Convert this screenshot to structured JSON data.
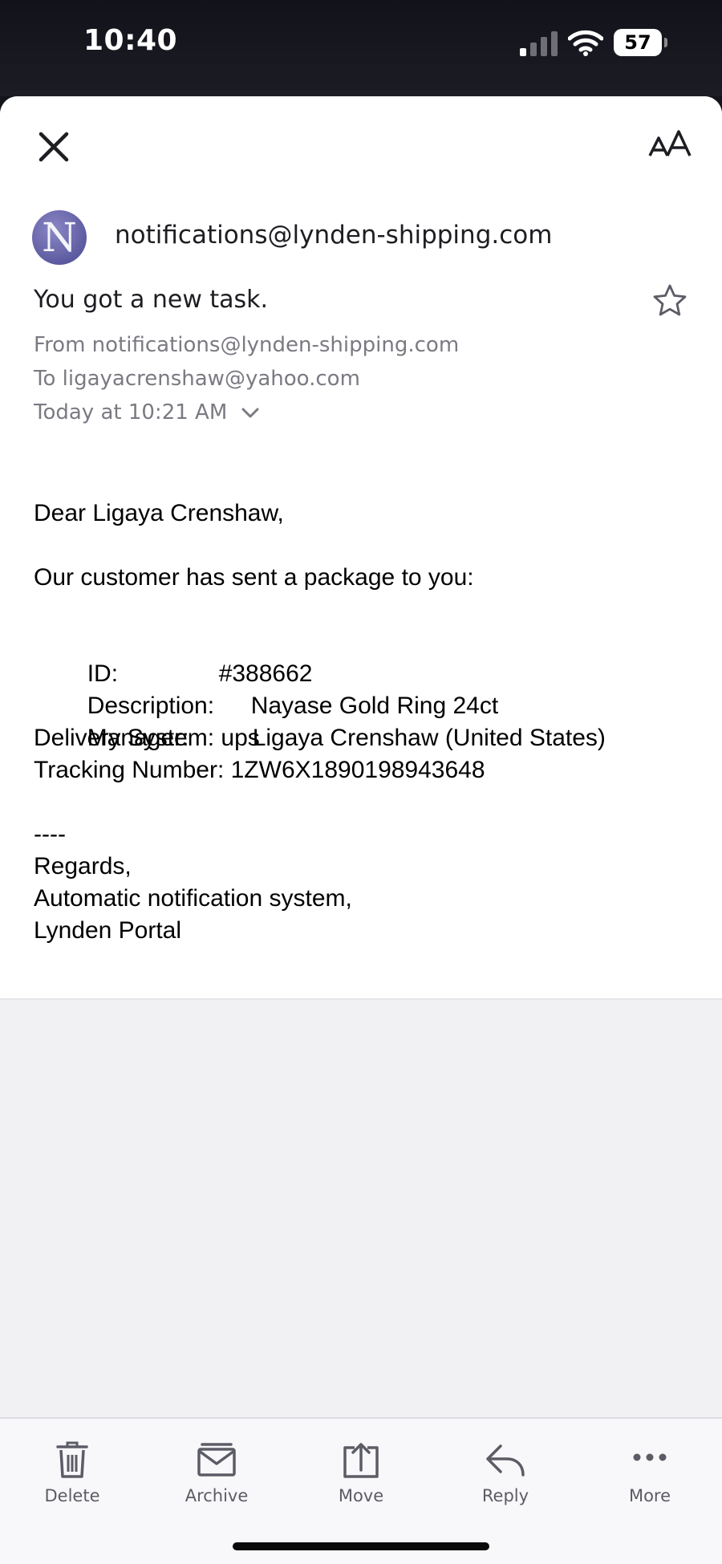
{
  "status_bar": {
    "time": "10:40",
    "battery_level": "57",
    "signal_icon": "cellular-signal-icon",
    "wifi_icon": "wifi-icon",
    "text_color": "#ffffff"
  },
  "header": {
    "close_icon": "close-icon",
    "text_size_icon": "text-size-icon"
  },
  "message": {
    "avatar_letter": "N",
    "avatar_color": "#5a58a0",
    "sender": "notifications@lynden-shipping.com",
    "subject": "You got a new task.",
    "star_icon": "star-icon",
    "from_line": "From notifications@lynden-shipping.com",
    "to_line": "To ligayacrenshaw@yahoo.com",
    "date_line": "Today at 10:21 AM",
    "body": {
      "greeting": "Dear Ligaya Crenshaw,",
      "intro": "Our customer has sent a package to you:",
      "fields": {
        "id_label": "ID:",
        "id_value": "#388662",
        "description_label": "Description:",
        "description_value": "Nayase Gold Ring 24ct",
        "manager_label": "Manager:",
        "manager_value": "Ligaya Crenshaw (United States)",
        "delivery_line": "Delivery System: ups",
        "tracking_line": "Tracking Number: 1ZW6X1890198943648"
      },
      "separator": "----",
      "regards": "Regards,",
      "signature_1": "Automatic notification system,",
      "signature_2": "Lynden Portal"
    }
  },
  "toolbar": {
    "items": [
      {
        "label": "Delete",
        "icon": "trash-icon"
      },
      {
        "label": "Archive",
        "icon": "archive-icon"
      },
      {
        "label": "Move",
        "icon": "move-icon"
      },
      {
        "label": "Reply",
        "icon": "reply-icon"
      },
      {
        "label": "More",
        "icon": "more-icon"
      }
    ]
  },
  "colors": {
    "sheet_background": "#f1f1f4",
    "card_background": "#ffffff",
    "meta_text": "#7a7a82",
    "toolbar_icon": "#5c5c66"
  }
}
